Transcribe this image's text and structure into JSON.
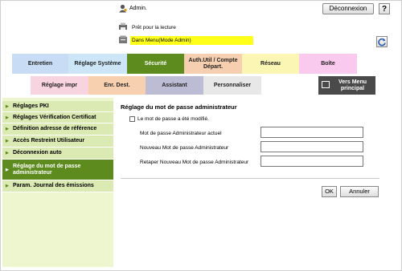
{
  "header": {
    "user_label": "Admin.",
    "logout_label": "Déconnexion",
    "help_label": "?",
    "status_text": "Prêt pour la lecture",
    "mode_text": "Dans Menu(Mode Admin)"
  },
  "tabs_row1": [
    {
      "label": "Entretien",
      "color": "#c9dcf5"
    },
    {
      "label": "Réglage Système",
      "color": "#cce6f7"
    },
    {
      "label": "Sécurité",
      "color": "#5e8b1e",
      "active": true
    },
    {
      "label": "Auth.Util / Compte Départ.",
      "color": "#f6cfb0"
    },
    {
      "label": "Réseau",
      "color": "#fbf6b4"
    },
    {
      "label": "Boîte",
      "color": "#f9c9ee"
    }
  ],
  "tabs_row2": [
    {
      "label": "Réglage impr",
      "color": "#f8d4e0"
    },
    {
      "label": "Enr. Dest.",
      "color": "#f7d0b0"
    },
    {
      "label": "Assistant",
      "color": "#bcbcd4"
    },
    {
      "label": "Personnaliser",
      "color": "#e8e8e8"
    }
  ],
  "vers_menu_label": "Vers Menu principal",
  "sidebar": {
    "items": [
      {
        "label": "Réglages PKI"
      },
      {
        "label": "Réglages Vérification Certificat"
      },
      {
        "label": "Définition adresse de référence"
      },
      {
        "label": "Accès Restreint Utilisateur"
      },
      {
        "label": "Déconnexion auto"
      },
      {
        "label": "Réglage du mot de passe administrateur",
        "active": true
      },
      {
        "label": "Param. Journal des émissions"
      }
    ]
  },
  "main": {
    "title": "Réglage du mot de passe administrateur",
    "checkbox_label": "Le mot de passe a été modifié.",
    "fields": [
      {
        "label": "Mot de passe Administrateur actuel",
        "value": ""
      },
      {
        "label": "Nouveau Mot de passe Administrateur",
        "value": ""
      },
      {
        "label": "Retaper Nouveau Mot de passe Administrateur",
        "value": ""
      }
    ],
    "ok_label": "OK",
    "cancel_label": "Annuler"
  },
  "colors": {
    "accent_green": "#5e8b1e",
    "sidebar_bg": "#eef6cf",
    "mode_bar": "#ffff19"
  }
}
